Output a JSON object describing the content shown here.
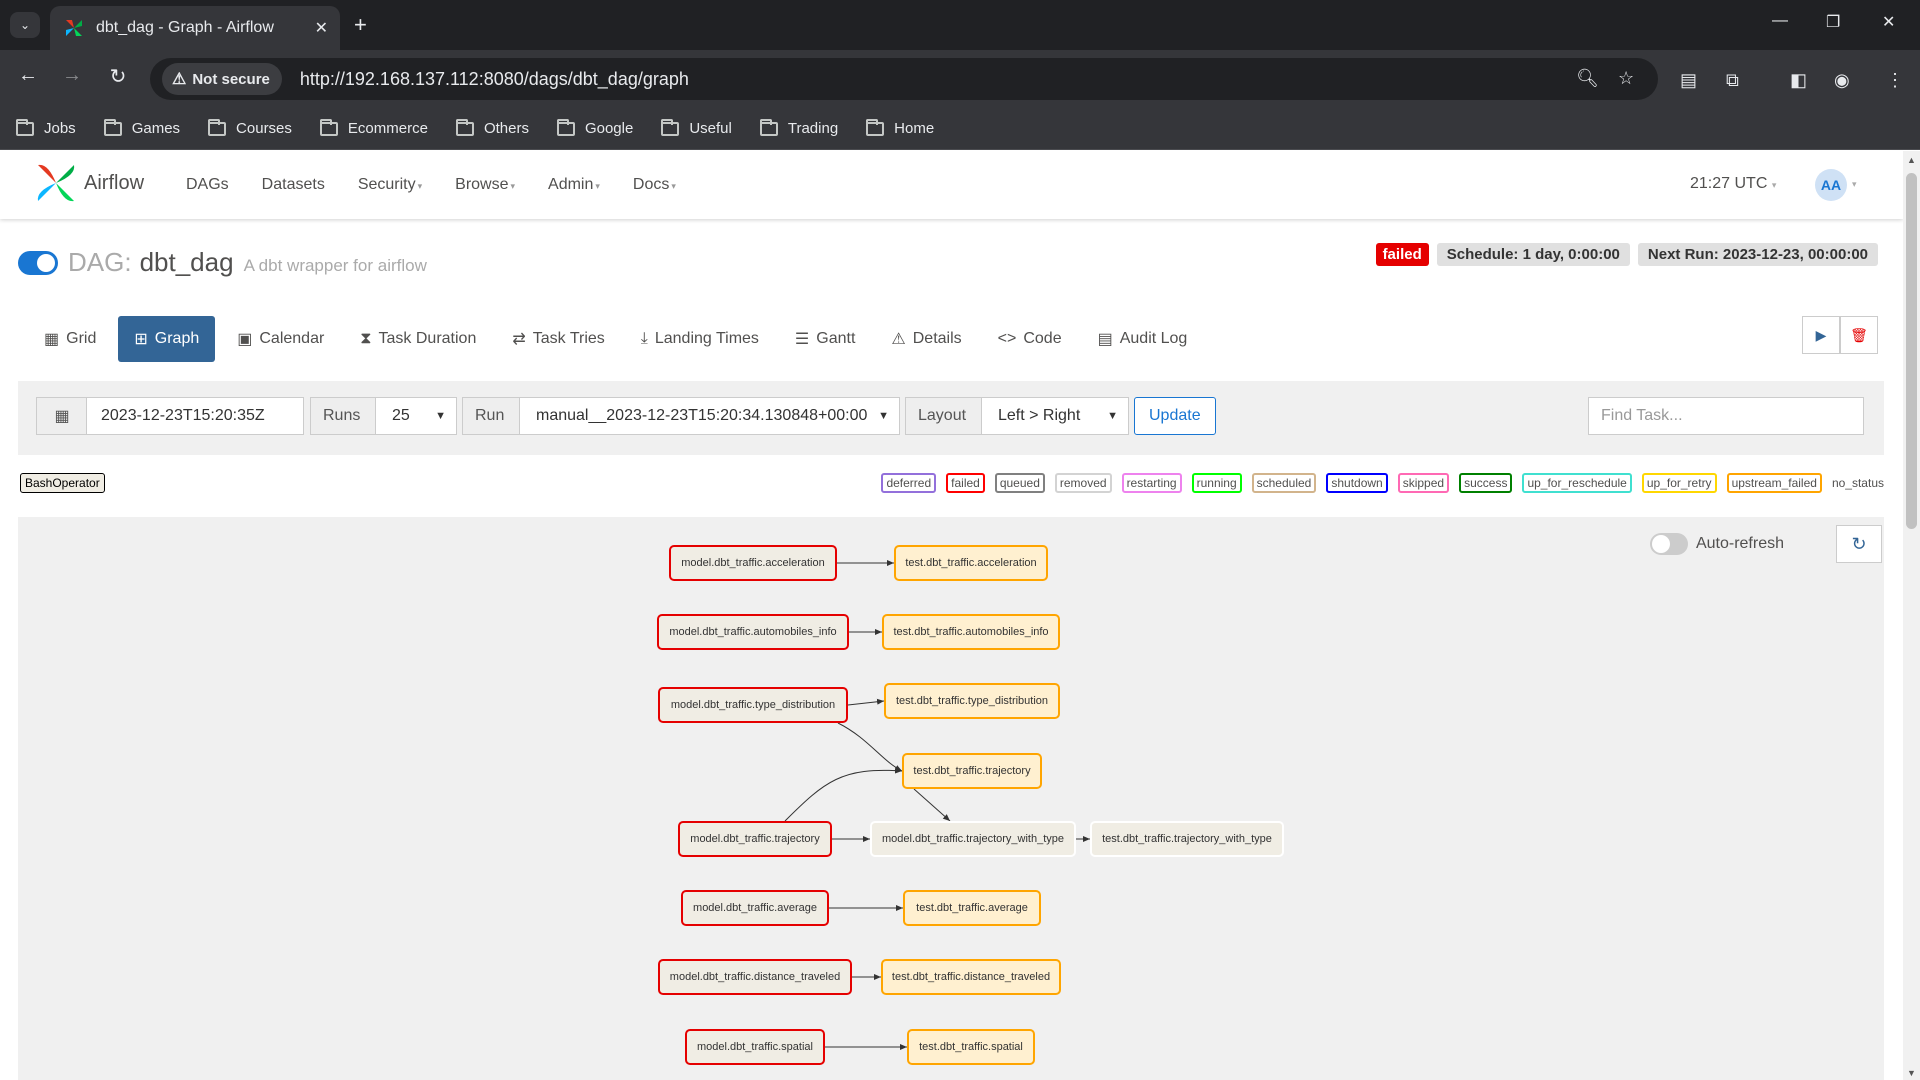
{
  "browser": {
    "tab_title": "dbt_dag - Graph - Airflow",
    "not_secure": "Not secure",
    "url": "http://192.168.137.112:8080/dags/dbt_dag/graph",
    "bookmarks": [
      "Jobs",
      "Games",
      "Courses",
      "Ecommerce",
      "Others",
      "Google",
      "Useful",
      "Trading",
      "Home"
    ]
  },
  "navbar": {
    "logo": "Airflow",
    "menu": [
      "DAGs",
      "Datasets",
      "Security",
      "Browse",
      "Admin",
      "Docs"
    ],
    "time": "21:27 UTC",
    "user_initials": "AA"
  },
  "dag": {
    "label": "DAG:",
    "name": "dbt_dag",
    "description": "A dbt wrapper for airflow",
    "status": "failed",
    "schedule": "Schedule: 1 day, 0:00:00",
    "next_run": "Next Run: 2023-12-23, 00:00:00"
  },
  "view_tabs": [
    "Grid",
    "Graph",
    "Calendar",
    "Task Duration",
    "Task Tries",
    "Landing Times",
    "Gantt",
    "Details",
    "Code",
    "Audit Log"
  ],
  "controls": {
    "date": "2023-12-23T15:20:35Z",
    "runs_label": "Runs",
    "runs_value": "25",
    "run_label": "Run",
    "run_value": "manual__2023-12-23T15:20:34.130848+00:00",
    "layout_label": "Layout",
    "layout_value": "Left > Right",
    "update": "Update",
    "find_placeholder": "Find Task..."
  },
  "operator": "BashOperator",
  "states": [
    {
      "label": "deferred",
      "color": "#9370db"
    },
    {
      "label": "failed",
      "color": "#ff0000"
    },
    {
      "label": "queued",
      "color": "#808080"
    },
    {
      "label": "removed",
      "color": "#d3d3d3"
    },
    {
      "label": "restarting",
      "color": "#ee82ee"
    },
    {
      "label": "running",
      "color": "#00ff00"
    },
    {
      "label": "scheduled",
      "color": "#d2b48c"
    },
    {
      "label": "shutdown",
      "color": "#0000ff"
    },
    {
      "label": "skipped",
      "color": "#ff69b4"
    },
    {
      "label": "success",
      "color": "#008000"
    },
    {
      "label": "up_for_reschedule",
      "color": "#40e0d0"
    },
    {
      "label": "up_for_retry",
      "color": "#ffd700"
    },
    {
      "label": "upstream_failed",
      "color": "#ffa500"
    },
    {
      "label": "no_status",
      "color": ""
    }
  ],
  "graph": {
    "auto_refresh": "Auto-refresh",
    "nodes": [
      {
        "id": "m_acc",
        "label": "model.dbt_traffic.acceleration",
        "state": "failed"
      },
      {
        "id": "t_acc",
        "label": "test.dbt_traffic.acceleration",
        "state": "upstream_failed"
      },
      {
        "id": "m_auto",
        "label": "model.dbt_traffic.automobiles_info",
        "state": "failed"
      },
      {
        "id": "t_auto",
        "label": "test.dbt_traffic.automobiles_info",
        "state": "upstream_failed"
      },
      {
        "id": "m_type",
        "label": "model.dbt_traffic.type_distribution",
        "state": "failed"
      },
      {
        "id": "t_type",
        "label": "test.dbt_traffic.type_distribution",
        "state": "upstream_failed"
      },
      {
        "id": "t_traj",
        "label": "test.dbt_traffic.trajectory",
        "state": "upstream_failed"
      },
      {
        "id": "m_traj",
        "label": "model.dbt_traffic.trajectory",
        "state": "failed"
      },
      {
        "id": "m_twt",
        "label": "model.dbt_traffic.trajectory_with_type",
        "state": "no_status"
      },
      {
        "id": "t_twt",
        "label": "test.dbt_traffic.trajectory_with_type",
        "state": "no_status"
      },
      {
        "id": "m_avg",
        "label": "model.dbt_traffic.average",
        "state": "failed"
      },
      {
        "id": "t_avg",
        "label": "test.dbt_traffic.average",
        "state": "upstream_failed"
      },
      {
        "id": "m_dist",
        "label": "model.dbt_traffic.distance_traveled",
        "state": "failed"
      },
      {
        "id": "t_dist",
        "label": "test.dbt_traffic.distance_traveled",
        "state": "upstream_failed"
      },
      {
        "id": "m_spa",
        "label": "model.dbt_traffic.spatial",
        "state": "failed"
      },
      {
        "id": "t_spa",
        "label": "test.dbt_traffic.spatial",
        "state": "upstream_failed"
      }
    ]
  }
}
